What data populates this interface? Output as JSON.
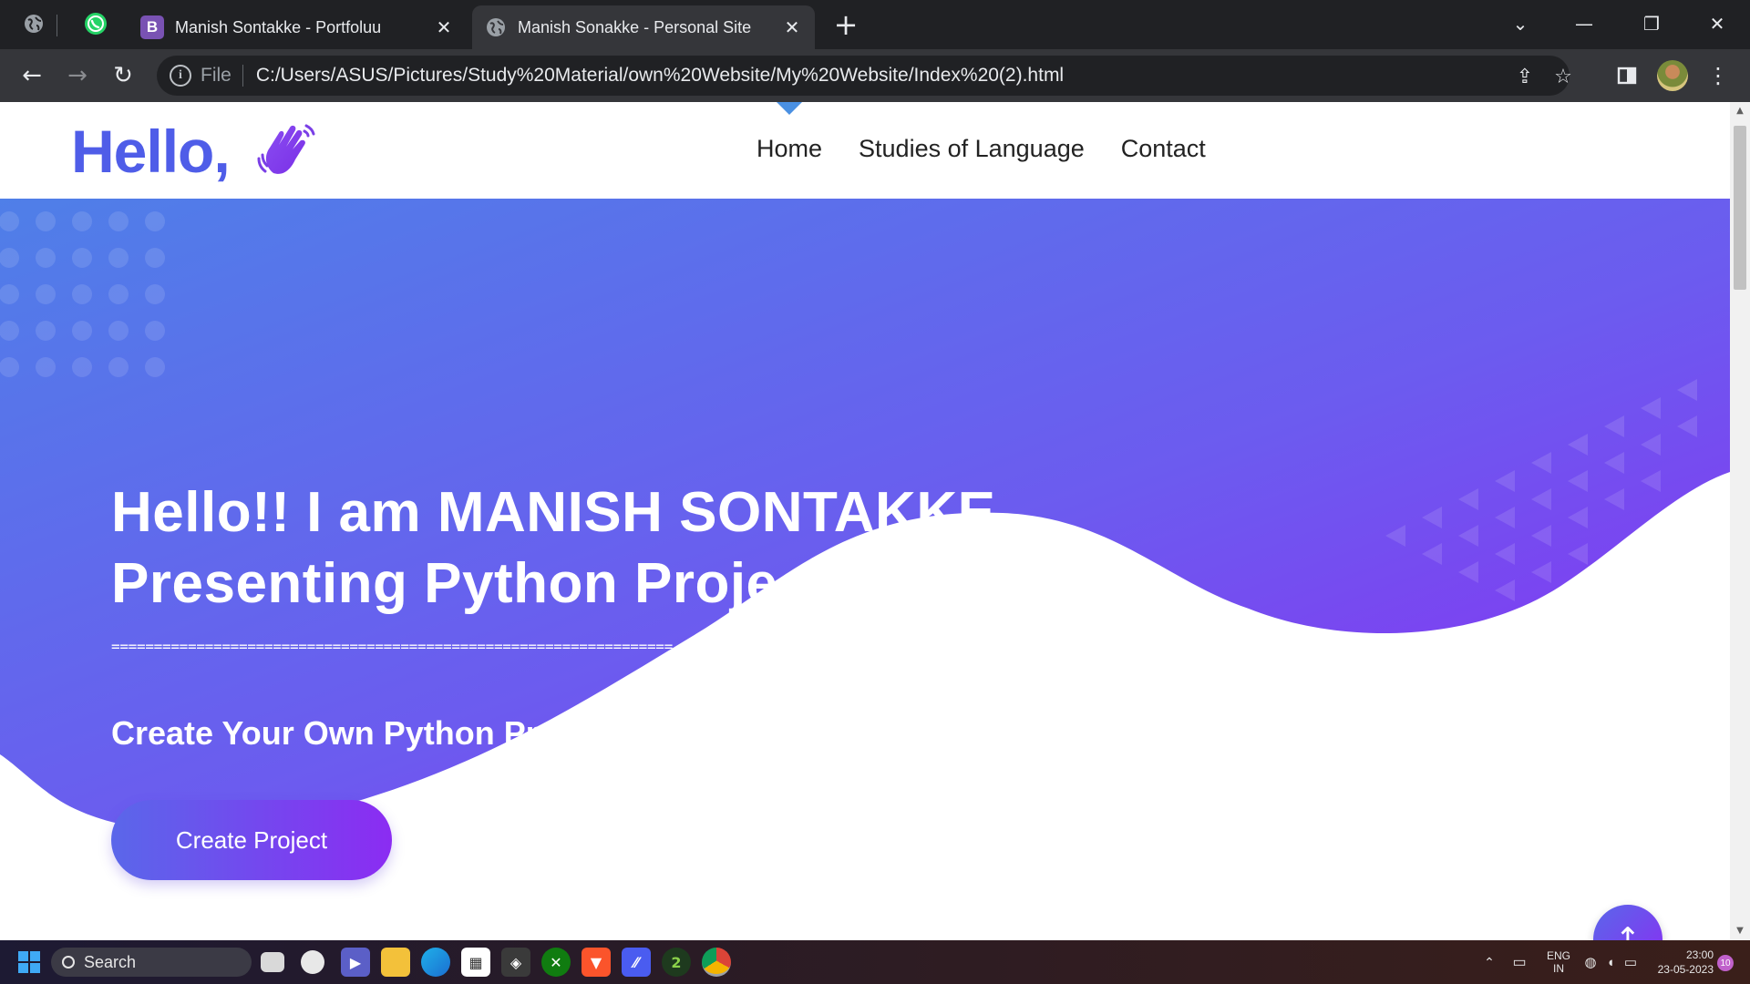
{
  "browser": {
    "tabs": [
      {
        "title": "Manish Sontakke - Portfoluu",
        "icon": "bootstrap-icon",
        "active": false
      },
      {
        "title": "Manish Sonakke - Personal Site",
        "icon": "globe-icon",
        "active": true
      }
    ],
    "address": {
      "scheme_label": "File",
      "url": "C:/Users/ASUS/Pictures/Study%20Material/own%20Website/My%20Website/Index%20(2).html"
    },
    "favicon_b": "B"
  },
  "site": {
    "logo_text": "Hello,",
    "nav": [
      {
        "label": "Home",
        "active": true
      },
      {
        "label": "Studies of Language",
        "active": false
      },
      {
        "label": "Contact",
        "active": false
      }
    ],
    "hero": {
      "title_line1": "Hello!! I am MANISH SONTAKKE,",
      "title_line2": "Presenting Python Projects",
      "rule": "==================================================================",
      "subtitle": "Create Your Own Python Project",
      "cta_label": "Create Project"
    },
    "colors": {
      "brand": "#4f5de8",
      "gradient_start": "#4f7fe8",
      "gradient_end": "#8a2cf3"
    }
  },
  "taskbar": {
    "search_label": "Search",
    "language_primary": "ENG",
    "language_secondary": "IN",
    "time": "23:00",
    "date": "23-05-2023",
    "notification_count": "10"
  }
}
